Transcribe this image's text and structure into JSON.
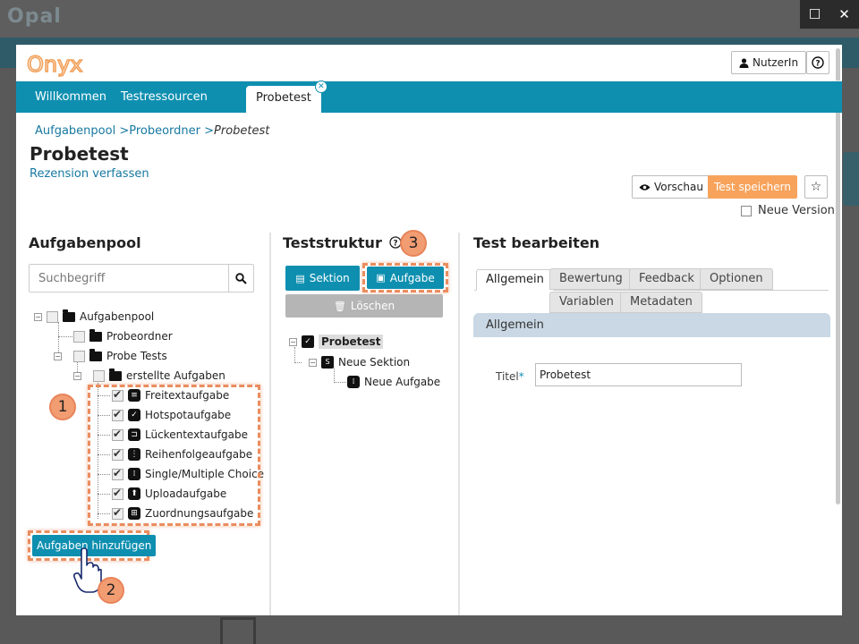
{
  "background": {
    "logo": "Opal"
  },
  "window_controls": {
    "maximize": "☐",
    "close": "✕"
  },
  "header": {
    "logo_text": "Onyx",
    "user_button": "NutzerIn",
    "help_button": "?"
  },
  "nav": {
    "items": [
      "Willkommen",
      "Testressourcen"
    ],
    "active_tab": "Probetest"
  },
  "breadcrumb": {
    "items": [
      "Aufgabenpool",
      "Probeordner"
    ],
    "current": "Probetest"
  },
  "page": {
    "title": "Probetest",
    "review_link": "Rezension verfassen"
  },
  "toolbar": {
    "preview": "Vorschau",
    "save": "Test speichern",
    "new_version": "Neue Version"
  },
  "pool": {
    "title": "Aufgabenpool",
    "search_placeholder": "Suchbegriff",
    "tree": {
      "root": "Aufgabenpool",
      "folder1": "Probeordner",
      "folder2": "Probe Tests",
      "subfolder": "erstellte Aufgaben",
      "items": [
        "Freitextaufgabe",
        "Hotspotaufgabe",
        "Lückentextaufgabe",
        "Reihenfolgeaufgabe",
        "Single/Multiple Choice",
        "Uploadaufgabe",
        "Zuordnungsaufgabe"
      ]
    },
    "add_button": "Aufgaben hinzufügen"
  },
  "structure": {
    "title": "Teststruktur",
    "section_button": "Sektion",
    "task_button": "Aufgabe",
    "delete_button": "Löschen",
    "tree": {
      "root": "Probetest",
      "section": "Neue Sektion",
      "task": "Neue Aufgabe"
    }
  },
  "edit": {
    "title": "Test bearbeiten",
    "tabs_row1": [
      "Allgemein",
      "Bewertung",
      "Feedback",
      "Optionen"
    ],
    "tabs_row2": [
      "Variablen",
      "Metadaten"
    ],
    "panel_title": "Allgemein",
    "title_label": "Titel",
    "required_mark": "*",
    "title_value": "Probetest"
  },
  "callouts": [
    "1",
    "2",
    "3"
  ],
  "colors": {
    "accent": "#0e8fb0",
    "save": "#f7a35c",
    "highlight": "#ea8d5f",
    "panel": "#c9d8e4"
  }
}
